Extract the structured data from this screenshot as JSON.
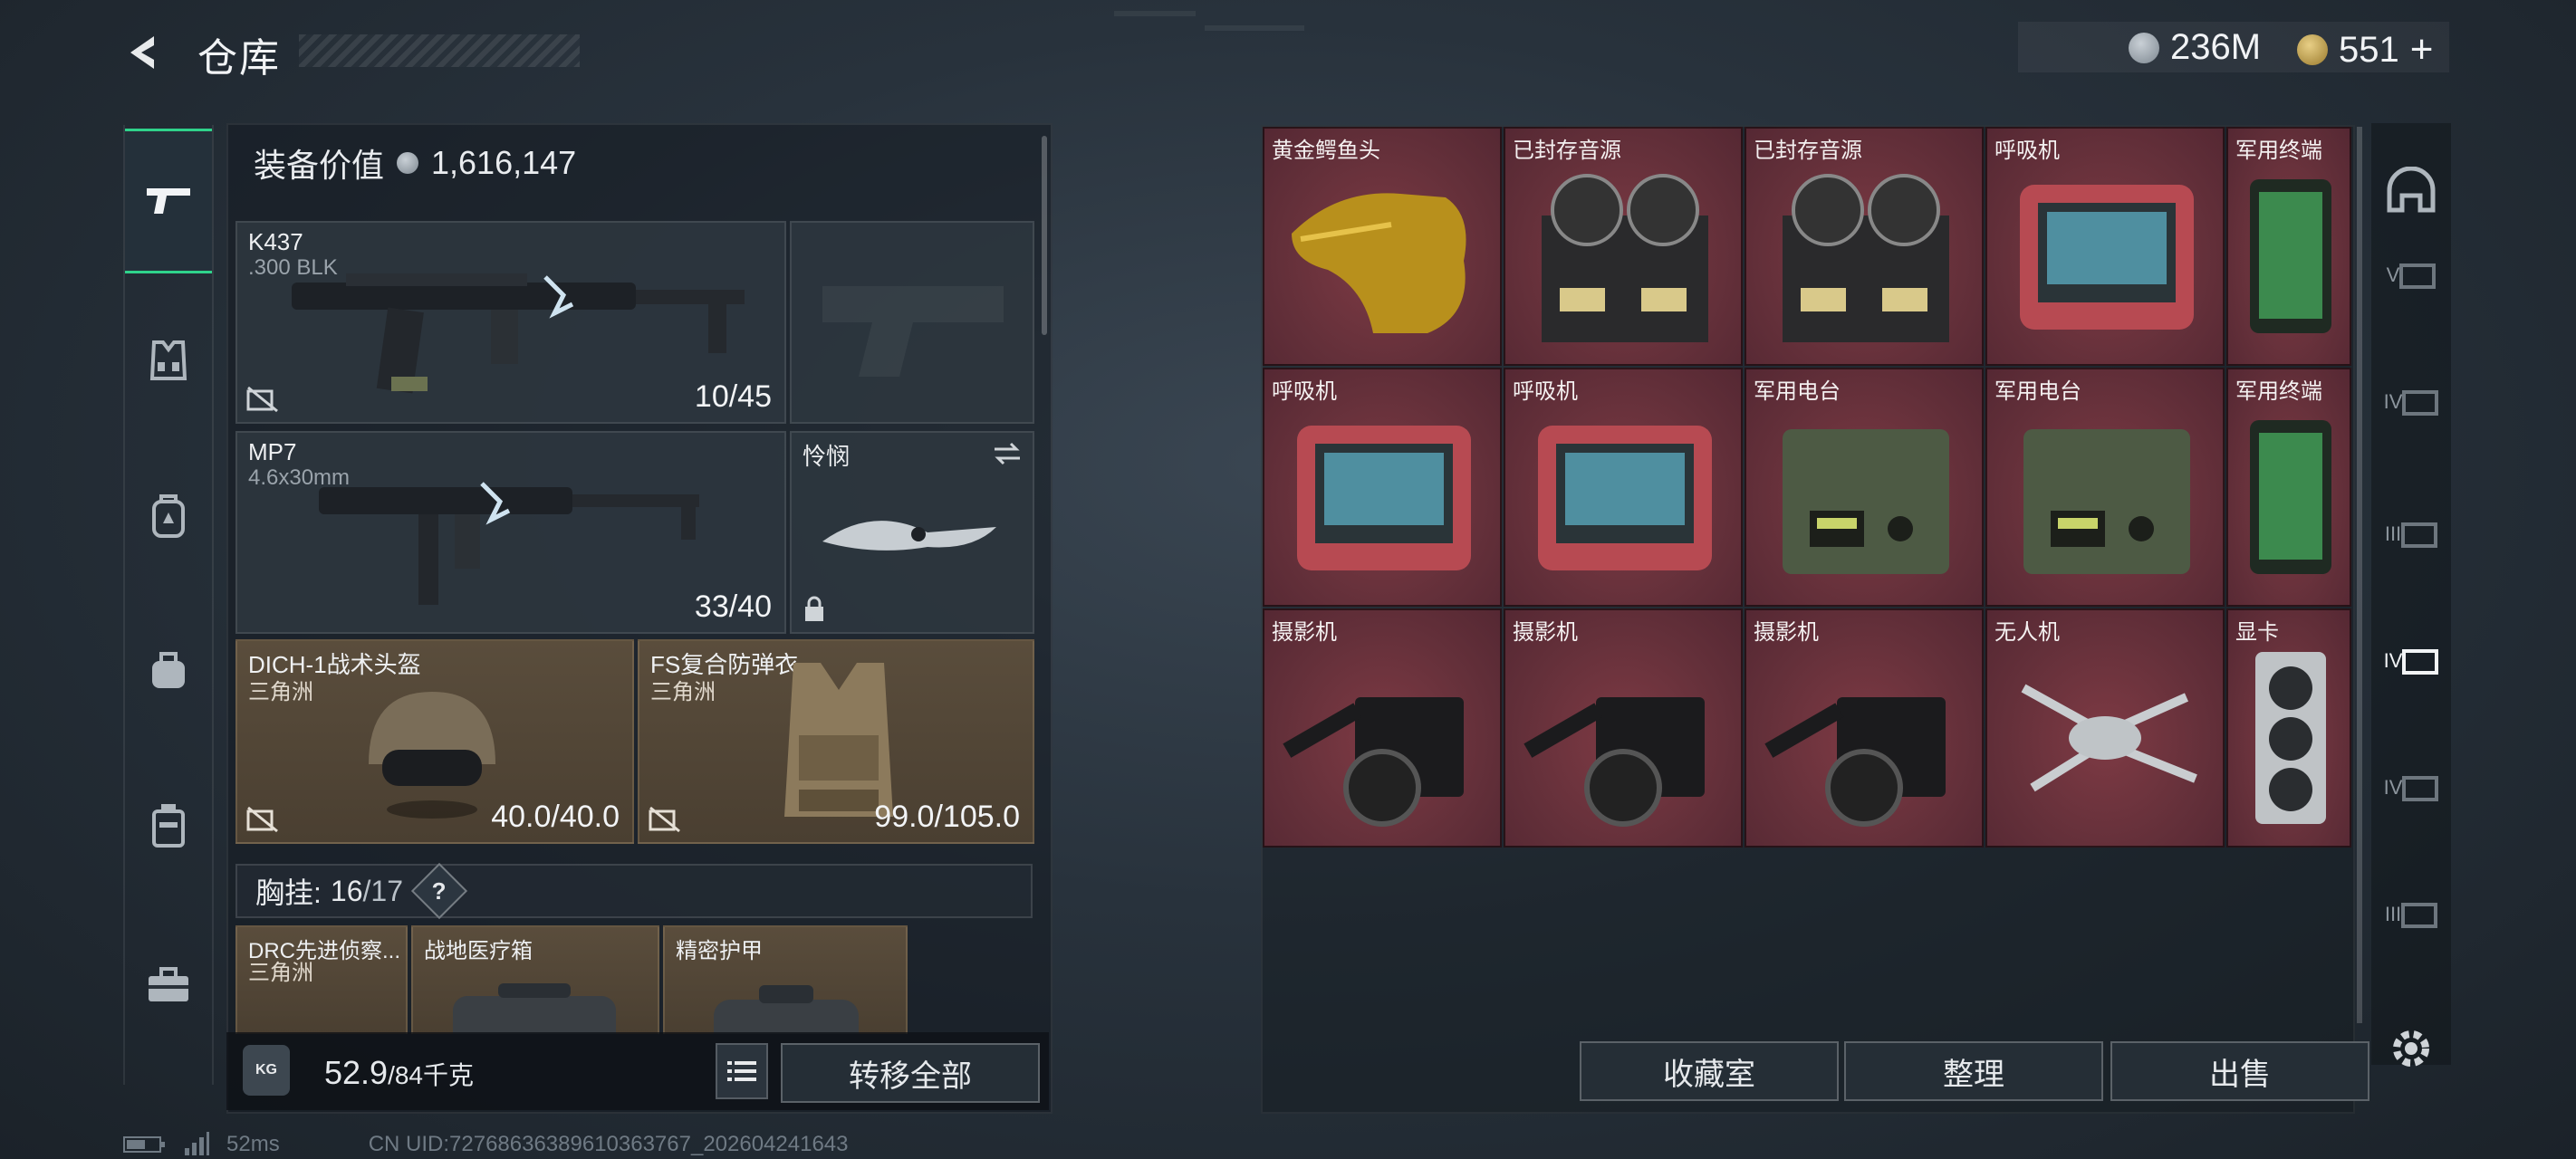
{
  "header": {
    "title": "仓库",
    "currency1": "236M",
    "currency2": "551",
    "add_symbol": "+"
  },
  "nav": [
    "weapon-pistol-icon",
    "vest-icon",
    "backpack-icon",
    "bag-icon",
    "case-icon",
    "toolbox-icon"
  ],
  "equipment": {
    "value_label": "装备价值",
    "value": "1,616,147",
    "primary": {
      "name": "K437",
      "ammo": ".300 BLK",
      "count": "10/45"
    },
    "secondary": {
      "name": "MP7",
      "ammo": "4.6x30mm",
      "count": "33/40"
    },
    "melee": {
      "name": "怜悯"
    },
    "helmet": {
      "name": "DICH-1战术头盔",
      "origin": "三角洲",
      "durability": "40.0/40.0"
    },
    "armor": {
      "name": "FS复合防弹衣",
      "origin": "三角洲",
      "durability": "99.0/105.0"
    },
    "chest_rig": {
      "label": "胸挂:",
      "used": "16",
      "total": "/17",
      "help": "?"
    },
    "rig_items": [
      {
        "name": "DRC先进侦察...",
        "origin": "三角洲"
      },
      {
        "name": "战地医疗箱"
      },
      {
        "name": "精密护甲"
      }
    ],
    "weight": {
      "current": "52.9",
      "max": "/84千克",
      "kg_icon": "KG"
    },
    "transfer_all": "转移全部"
  },
  "stash": {
    "items": [
      "黄金鳄鱼头",
      "已封存音源",
      "已封存音源",
      "呼吸机",
      "军用终端",
      "呼吸机",
      "呼吸机",
      "军用电台",
      "军用电台",
      "军用终端",
      "摄影机",
      "摄影机",
      "摄影机",
      "无人机",
      "显卡"
    ],
    "buttons": {
      "collection": "收藏室",
      "sort": "整理",
      "sell": "出售"
    }
  },
  "rail": [
    "helmet-icon",
    "V",
    "IV",
    "III",
    "IV",
    "IV",
    "III"
  ],
  "footer": {
    "ping": "52ms",
    "uid": "CN UID:7276863638961036376​7_202604241643"
  },
  "colors": {
    "accent": "#2fd38b",
    "cell_red": "#64303a",
    "tan_slot": "#5a4d3c"
  }
}
